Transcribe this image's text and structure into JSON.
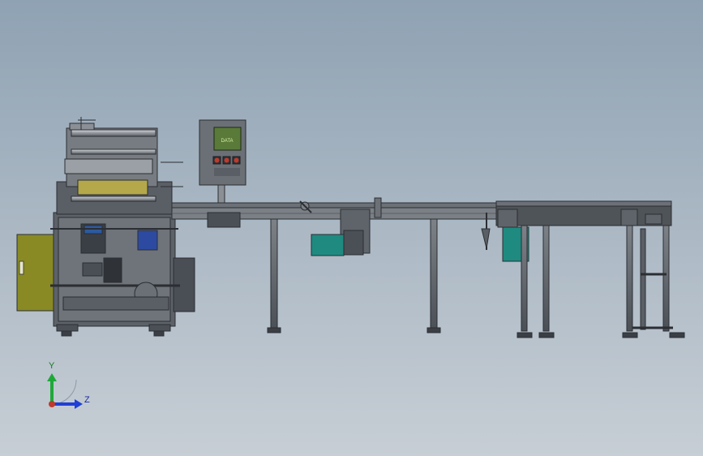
{
  "viewport": {
    "background_top": "#8fa2b3",
    "background_bottom": "#c7ced5"
  },
  "control_panel": {
    "screen_text": "DATA",
    "screen_color": "#5a7a3a",
    "button_colors": [
      "#c0392b",
      "#c0392b",
      "#c0392b"
    ]
  },
  "machine": {
    "electrical_cabinet_color": "#8a8a24",
    "motor_color": "#1f8a80"
  },
  "triad": {
    "y_label": "Y",
    "z_label": "Z",
    "y_color": "#1fa83a",
    "z_color": "#1f3fd6",
    "x_color": "#c0392b"
  }
}
